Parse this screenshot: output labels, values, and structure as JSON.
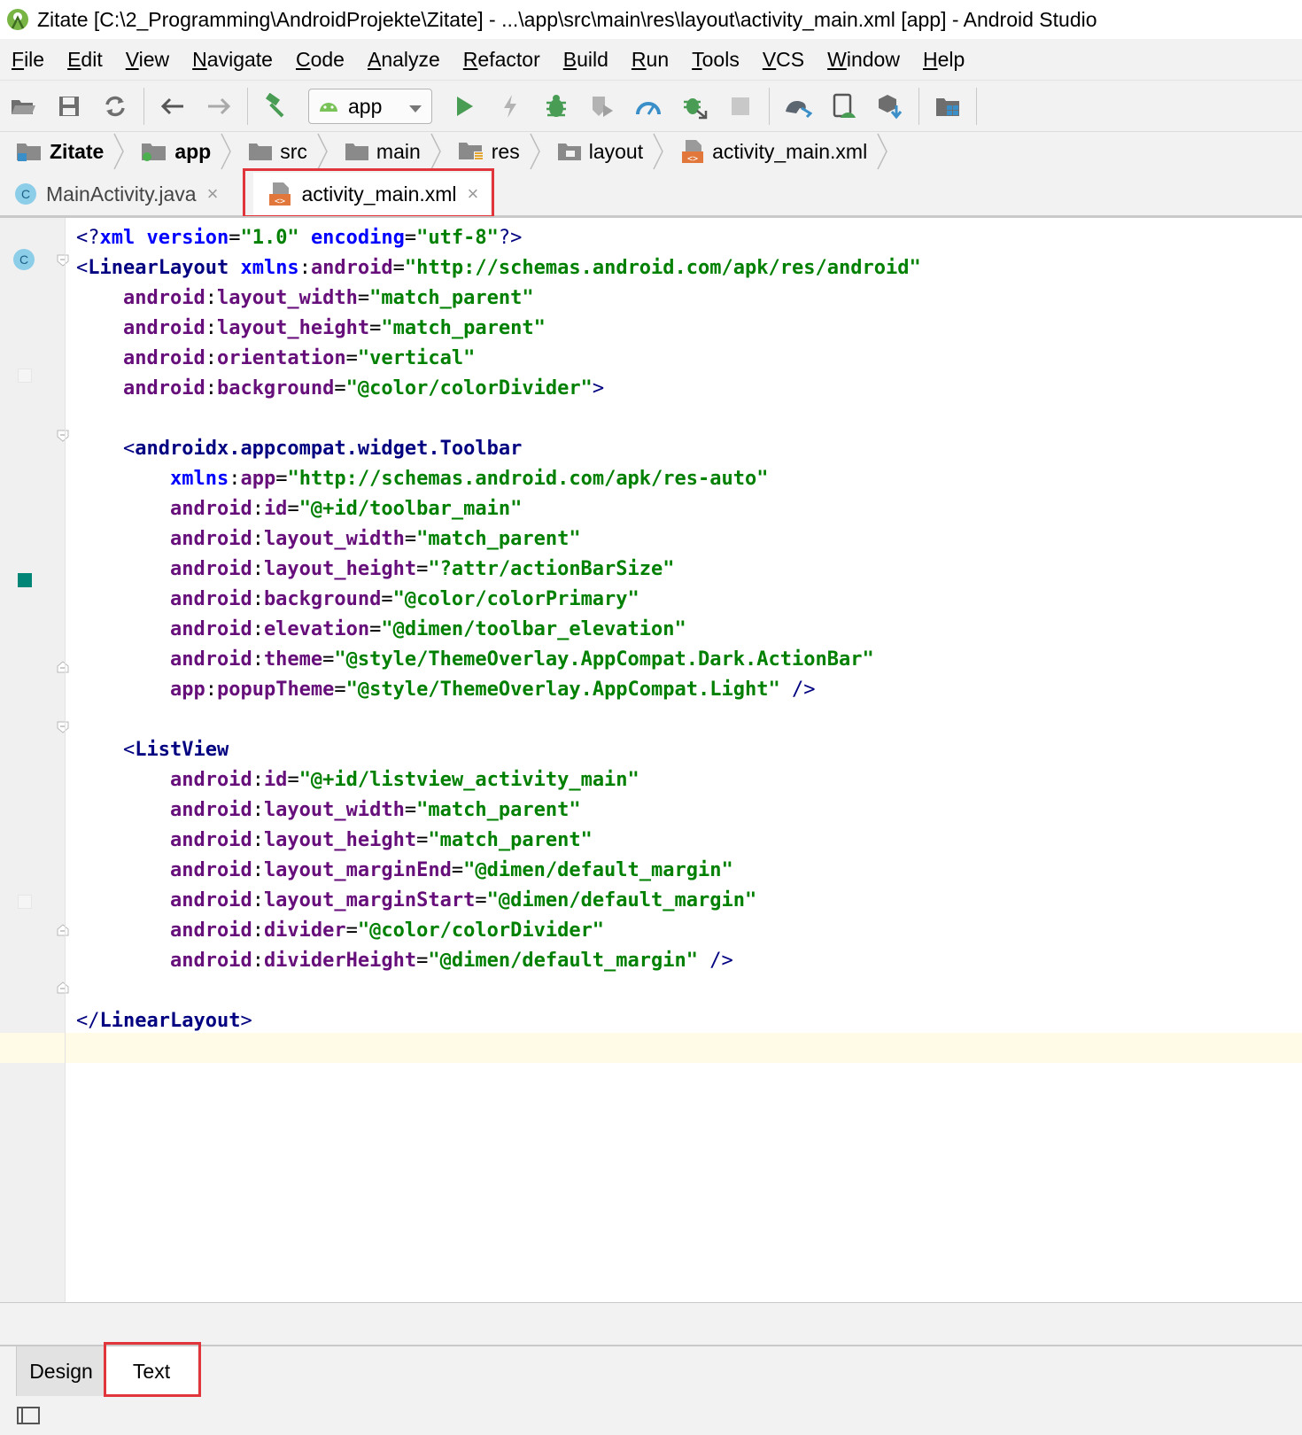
{
  "window": {
    "title": "Zitate [C:\\2_Programming\\AndroidProjekte\\Zitate] - ...\\app\\src\\main\\res\\layout\\activity_main.xml [app] - Android Studio"
  },
  "menu": [
    "File",
    "Edit",
    "View",
    "Navigate",
    "Code",
    "Analyze",
    "Refactor",
    "Build",
    "Run",
    "Tools",
    "VCS",
    "Window",
    "Help"
  ],
  "toolbar": {
    "run_config": "app",
    "icons": [
      "open-folder",
      "save",
      "sync",
      "back-arrow",
      "forward-arrow",
      "build-hammer",
      "run",
      "apply-changes",
      "debug",
      "profile-coverage",
      "profiler",
      "attach-debugger",
      "stop",
      "gradle-sync",
      "avd-manager",
      "sdk-manager",
      "project-structure"
    ]
  },
  "breadcrumb": [
    {
      "label": "Zitate",
      "icon": "project-folder-icon",
      "bold": true
    },
    {
      "label": "app",
      "icon": "module-folder-icon",
      "bold": true
    },
    {
      "label": "src",
      "icon": "folder-icon",
      "bold": false
    },
    {
      "label": "main",
      "icon": "folder-icon",
      "bold": false
    },
    {
      "label": "res",
      "icon": "res-folder-icon",
      "bold": false
    },
    {
      "label": "layout",
      "icon": "layout-folder-icon",
      "bold": false
    },
    {
      "label": "activity_main.xml",
      "icon": "xml-layout-file-icon",
      "bold": false
    }
  ],
  "tabs": [
    {
      "label": "MainActivity.java",
      "icon": "java-class-icon",
      "close": "×",
      "active": false
    },
    {
      "label": "activity_main.xml",
      "icon": "xml-layout-file-icon",
      "close": "×",
      "active": true
    }
  ],
  "editor": {
    "lines": [
      [
        [
          "t-punct",
          "<?"
        ],
        [
          "t-prolog-kw",
          "xml "
        ],
        [
          "t-prolog-kw",
          "version"
        ],
        [
          "t-plain",
          "="
        ],
        [
          "t-val",
          "\"1.0\""
        ],
        [
          "t-plain",
          " "
        ],
        [
          "t-prolog-kw",
          "encoding"
        ],
        [
          "t-plain",
          "="
        ],
        [
          "t-val",
          "\"utf-8\""
        ],
        [
          "t-punct",
          "?>"
        ]
      ],
      [
        [
          "t-punct",
          "<"
        ],
        [
          "t-tag",
          "LinearLayout"
        ],
        [
          "t-plain",
          " "
        ],
        [
          "t-nsblue",
          "xmlns"
        ],
        [
          "t-plain",
          ":"
        ],
        [
          "t-ns",
          "android"
        ],
        [
          "t-plain",
          "="
        ],
        [
          "t-val",
          "\"http://schemas.android.com/apk/res/android\""
        ]
      ],
      [
        [
          "t-plain",
          "    "
        ],
        [
          "t-ns",
          "android"
        ],
        [
          "t-plain",
          ":"
        ],
        [
          "t-attr",
          "layout_width"
        ],
        [
          "t-plain",
          "="
        ],
        [
          "t-val",
          "\"match_parent\""
        ]
      ],
      [
        [
          "t-plain",
          "    "
        ],
        [
          "t-ns",
          "android"
        ],
        [
          "t-plain",
          ":"
        ],
        [
          "t-attr",
          "layout_height"
        ],
        [
          "t-plain",
          "="
        ],
        [
          "t-val",
          "\"match_parent\""
        ]
      ],
      [
        [
          "t-plain",
          "    "
        ],
        [
          "t-ns",
          "android"
        ],
        [
          "t-plain",
          ":"
        ],
        [
          "t-attr",
          "orientation"
        ],
        [
          "t-plain",
          "="
        ],
        [
          "t-val",
          "\"vertical\""
        ]
      ],
      [
        [
          "t-plain",
          "    "
        ],
        [
          "t-ns",
          "android"
        ],
        [
          "t-plain",
          ":"
        ],
        [
          "t-attr",
          "background"
        ],
        [
          "t-plain",
          "="
        ],
        [
          "t-val",
          "\"@color/colorDivider\""
        ],
        [
          "t-punct",
          ">"
        ]
      ],
      [],
      [
        [
          "t-plain",
          "    "
        ],
        [
          "t-punct",
          "<"
        ],
        [
          "t-tag",
          "androidx.appcompat.widget.Toolbar"
        ]
      ],
      [
        [
          "t-plain",
          "        "
        ],
        [
          "t-nsblue",
          "xmlns"
        ],
        [
          "t-plain",
          ":"
        ],
        [
          "t-ns",
          "app"
        ],
        [
          "t-plain",
          "="
        ],
        [
          "t-val",
          "\"http://schemas.android.com/apk/res-auto\""
        ]
      ],
      [
        [
          "t-plain",
          "        "
        ],
        [
          "t-ns",
          "android"
        ],
        [
          "t-plain",
          ":"
        ],
        [
          "t-attr",
          "id"
        ],
        [
          "t-plain",
          "="
        ],
        [
          "t-val",
          "\"@+id/toolbar_main\""
        ]
      ],
      [
        [
          "t-plain",
          "        "
        ],
        [
          "t-ns",
          "android"
        ],
        [
          "t-plain",
          ":"
        ],
        [
          "t-attr",
          "layout_width"
        ],
        [
          "t-plain",
          "="
        ],
        [
          "t-val",
          "\"match_parent\""
        ]
      ],
      [
        [
          "t-plain",
          "        "
        ],
        [
          "t-ns",
          "android"
        ],
        [
          "t-plain",
          ":"
        ],
        [
          "t-attr",
          "layout_height"
        ],
        [
          "t-plain",
          "="
        ],
        [
          "t-val",
          "\"?attr/actionBarSize\""
        ]
      ],
      [
        [
          "t-plain",
          "        "
        ],
        [
          "t-ns",
          "android"
        ],
        [
          "t-plain",
          ":"
        ],
        [
          "t-attr",
          "background"
        ],
        [
          "t-plain",
          "="
        ],
        [
          "t-val",
          "\"@color/colorPrimary\""
        ]
      ],
      [
        [
          "t-plain",
          "        "
        ],
        [
          "t-ns",
          "android"
        ],
        [
          "t-plain",
          ":"
        ],
        [
          "t-attr",
          "elevation"
        ],
        [
          "t-plain",
          "="
        ],
        [
          "t-val",
          "\"@dimen/toolbar_elevation\""
        ]
      ],
      [
        [
          "t-plain",
          "        "
        ],
        [
          "t-ns",
          "android"
        ],
        [
          "t-plain",
          ":"
        ],
        [
          "t-attr",
          "theme"
        ],
        [
          "t-plain",
          "="
        ],
        [
          "t-val",
          "\"@style/ThemeOverlay.AppCompat.Dark.ActionBar\""
        ]
      ],
      [
        [
          "t-plain",
          "        "
        ],
        [
          "t-ns",
          "app"
        ],
        [
          "t-plain",
          ":"
        ],
        [
          "t-attr",
          "popupTheme"
        ],
        [
          "t-plain",
          "="
        ],
        [
          "t-val",
          "\"@style/ThemeOverlay.AppCompat.Light\""
        ],
        [
          "t-plain",
          " "
        ],
        [
          "t-punct",
          "/>"
        ]
      ],
      [],
      [
        [
          "t-plain",
          "    "
        ],
        [
          "t-punct",
          "<"
        ],
        [
          "t-tag",
          "ListView"
        ]
      ],
      [
        [
          "t-plain",
          "        "
        ],
        [
          "t-ns",
          "android"
        ],
        [
          "t-plain",
          ":"
        ],
        [
          "t-attr",
          "id"
        ],
        [
          "t-plain",
          "="
        ],
        [
          "t-val",
          "\"@+id/listview_activity_main\""
        ]
      ],
      [
        [
          "t-plain",
          "        "
        ],
        [
          "t-ns",
          "android"
        ],
        [
          "t-plain",
          ":"
        ],
        [
          "t-attr",
          "layout_width"
        ],
        [
          "t-plain",
          "="
        ],
        [
          "t-val",
          "\"match_parent\""
        ]
      ],
      [
        [
          "t-plain",
          "        "
        ],
        [
          "t-ns",
          "android"
        ],
        [
          "t-plain",
          ":"
        ],
        [
          "t-attr",
          "layout_height"
        ],
        [
          "t-plain",
          "="
        ],
        [
          "t-val",
          "\"match_parent\""
        ]
      ],
      [
        [
          "t-plain",
          "        "
        ],
        [
          "t-ns",
          "android"
        ],
        [
          "t-plain",
          ":"
        ],
        [
          "t-attr",
          "layout_marginEnd"
        ],
        [
          "t-plain",
          "="
        ],
        [
          "t-val",
          "\"@dimen/default_margin\""
        ]
      ],
      [
        [
          "t-plain",
          "        "
        ],
        [
          "t-ns",
          "android"
        ],
        [
          "t-plain",
          ":"
        ],
        [
          "t-attr",
          "layout_marginStart"
        ],
        [
          "t-plain",
          "="
        ],
        [
          "t-val",
          "\"@dimen/default_margin\""
        ]
      ],
      [
        [
          "t-plain",
          "        "
        ],
        [
          "t-ns",
          "android"
        ],
        [
          "t-plain",
          ":"
        ],
        [
          "t-attr",
          "divider"
        ],
        [
          "t-plain",
          "="
        ],
        [
          "t-val",
          "\"@color/colorDivider\""
        ]
      ],
      [
        [
          "t-plain",
          "        "
        ],
        [
          "t-ns",
          "android"
        ],
        [
          "t-plain",
          ":"
        ],
        [
          "t-attr",
          "dividerHeight"
        ],
        [
          "t-plain",
          "="
        ],
        [
          "t-val",
          "\"@dimen/default_margin\""
        ],
        [
          "t-plain",
          " "
        ],
        [
          "t-punct",
          "/>"
        ]
      ],
      [],
      [
        [
          "t-punct",
          "</"
        ],
        [
          "t-tag",
          "LinearLayout"
        ],
        [
          "t-punct",
          ">"
        ]
      ],
      []
    ],
    "gutter_colors": {
      "colorDivider": "#f5f5f5",
      "colorPrimary": "#008577"
    }
  },
  "bottom_tabs": [
    {
      "label": "Design",
      "active": false
    },
    {
      "label": "Text",
      "active": true
    }
  ],
  "colors": {
    "highlight_box": "#e0363b",
    "caret_line": "#fffbe6",
    "tag": "#000080",
    "attribute": "#660e7a",
    "value": "#008000",
    "keyword": "#0000ff"
  }
}
